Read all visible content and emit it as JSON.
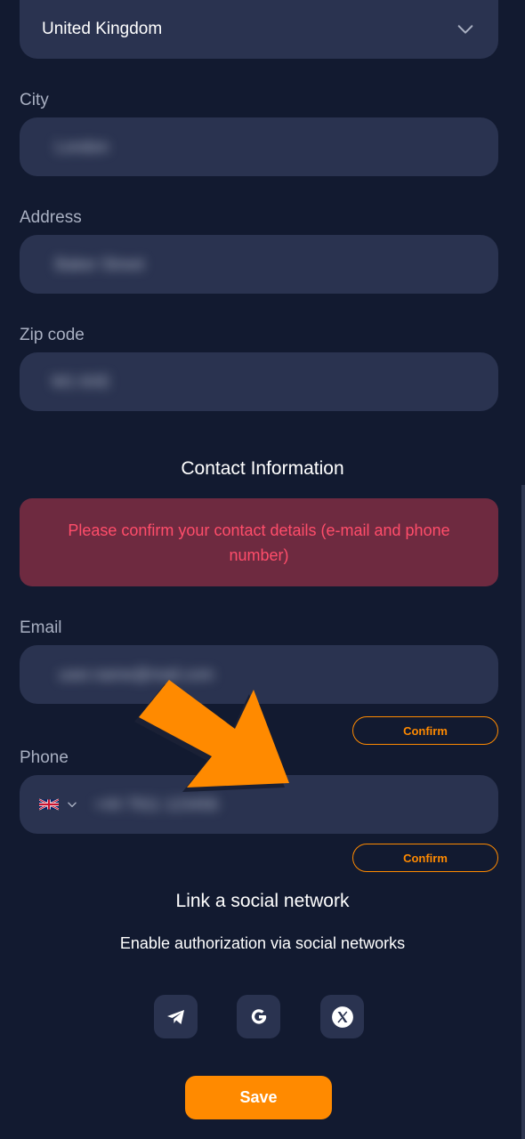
{
  "country": {
    "value": "United Kingdom"
  },
  "city": {
    "label": "City",
    "value": "London"
  },
  "address": {
    "label": "Address",
    "value": "Baker Street"
  },
  "zip": {
    "label": "Zip code",
    "value": "W1 6XE"
  },
  "contact": {
    "title": "Contact Information",
    "alert": "Please confirm your contact details (e-mail and phone number)"
  },
  "email": {
    "label": "Email",
    "value": "user.name@mail.com",
    "confirm_label": "Confirm"
  },
  "phone": {
    "label": "Phone",
    "value": "+44 7911 123456",
    "confirm_label": "Confirm",
    "country_flag": "uk-flag"
  },
  "social": {
    "title": "Link a social network",
    "subtitle": "Enable authorization via social networks",
    "icons": [
      "telegram-icon",
      "google-icon",
      "x-icon"
    ]
  },
  "save_label": "Save",
  "colors": {
    "accent": "#ff8a00",
    "background": "#121a30",
    "field": "#2a3350",
    "alert_bg": "#6e2a40",
    "alert_text": "#ff4d6a"
  }
}
